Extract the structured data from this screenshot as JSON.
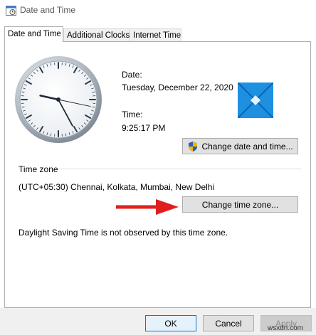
{
  "window": {
    "title": "Date and Time",
    "icon": "date-time-icon"
  },
  "tabs": [
    {
      "label": "Date and Time",
      "active": true
    },
    {
      "label": "Additional Clocks",
      "active": false
    },
    {
      "label": "Internet Time",
      "active": false
    }
  ],
  "date_section": {
    "date_label": "Date:",
    "date_value": "Tuesday, December 22, 2020",
    "time_label": "Time:",
    "time_value": "9:25:17 PM",
    "change_button": "Change date and time..."
  },
  "clock": {
    "time_shown": "9:25:17"
  },
  "time_zone": {
    "heading": "Time zone",
    "value": "(UTC+05:30) Chennai, Kolkata, Mumbai, New Delhi",
    "change_button": "Change time zone...",
    "dst_note": "Daylight Saving Time is not observed by this time zone."
  },
  "buttons": {
    "ok": "OK",
    "cancel": "Cancel",
    "apply": "Apply"
  },
  "watermark": "wsxdn.com",
  "colors": {
    "windows_logo": "#1e90e0",
    "arrow": "#e11e1e",
    "shield_blue": "#2b5fb8",
    "shield_gold": "#f2b705"
  }
}
